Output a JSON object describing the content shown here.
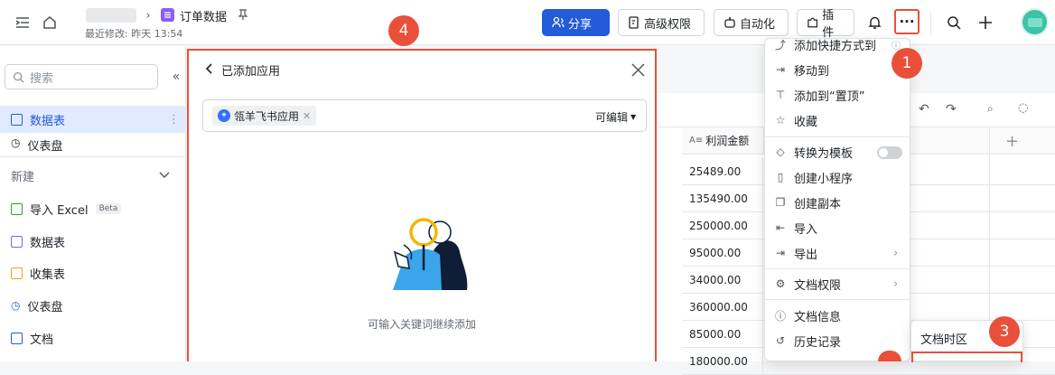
{
  "header": {
    "title": "订单数据",
    "last_modified": "最近修改: 昨天 13:54",
    "share_label": "分享",
    "advanced_permission_label": "高级权限",
    "automation_label": "自动化",
    "plugin_label": "插件",
    "more_label": "···"
  },
  "sidebar": {
    "search_placeholder": "搜索",
    "items": [
      {
        "label": "数据表"
      },
      {
        "label": "仪表盘"
      }
    ],
    "new_label": "新建",
    "new_items": [
      {
        "label": "导入 Excel",
        "badge": "Beta"
      },
      {
        "label": "数据表"
      },
      {
        "label": "收集表"
      },
      {
        "label": "仪表盘"
      },
      {
        "label": "文档"
      }
    ]
  },
  "modal": {
    "back_title": "已添加应用",
    "chip_label": "瓴羊飞书应用",
    "permission_label": "可编辑",
    "hint": "可输入关键词继续添加"
  },
  "grid": {
    "column_header": "利润金额",
    "values": [
      "25489.00",
      "135490.00",
      "250000.00",
      "95000.00",
      "34000.00",
      "360000.00",
      "85000.00",
      "180000.00"
    ]
  },
  "menu": {
    "items": [
      {
        "label": "添加快捷方式到"
      },
      {
        "label": "移动到"
      },
      {
        "label": "添加到“置顶”"
      },
      {
        "label": "收藏"
      },
      {
        "label": "转换为模板"
      },
      {
        "label": "创建小程序"
      },
      {
        "label": "创建副本"
      },
      {
        "label": "导入"
      },
      {
        "label": "导出"
      },
      {
        "label": "文档权限"
      },
      {
        "label": "文档信息"
      },
      {
        "label": "历史记录"
      }
    ]
  },
  "submenu": {
    "items": [
      {
        "label": "文档时区"
      }
    ]
  },
  "annotations": {
    "one": "1",
    "three": "3",
    "four": "4"
  },
  "colors": {
    "accent": "#245bdb",
    "highlight": "#e8503a"
  }
}
